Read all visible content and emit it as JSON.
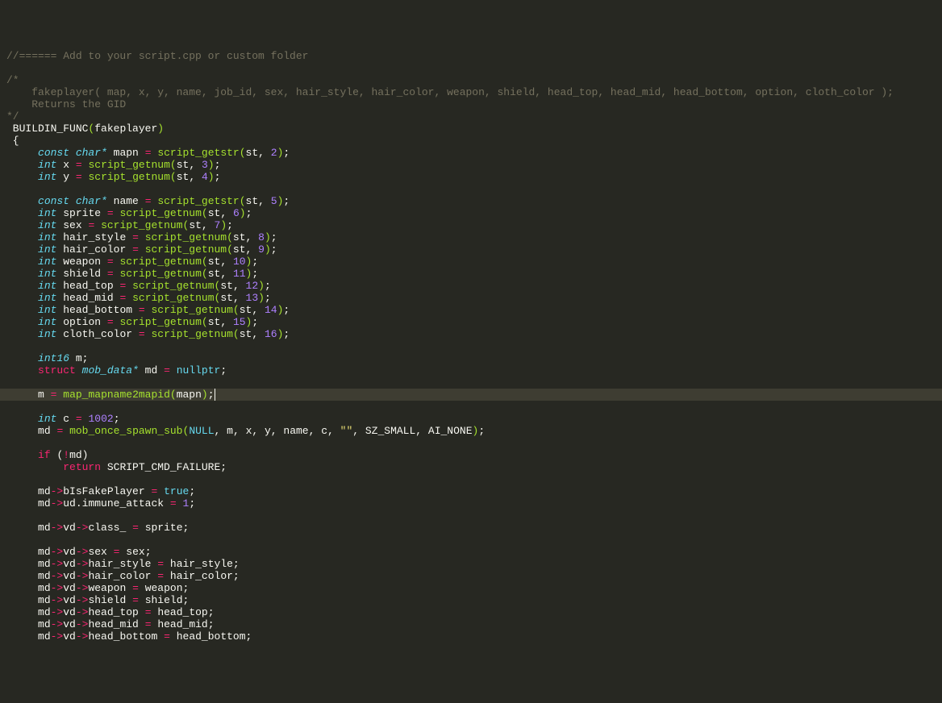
{
  "comment_header": "//====== Add to your script.cpp or custom folder",
  "comment_block": {
    "open": "/*",
    "line1": "    fakeplayer( map, x, y, name, job_id, sex, hair_style, hair_color, weapon, shield, head_top, head_mid, head_bottom, option, cloth_color );",
    "line2": "    Returns the GID",
    "close": "*/"
  },
  "buildin_func": "BUILDIN_FUNC",
  "funcname": "fakeplayer",
  "types": {
    "const_char_star": "const char*",
    "int": "int",
    "int16": "int16",
    "struct": "struct",
    "mob_data": "mob_data*"
  },
  "kw": {
    "if": "if",
    "return": "return",
    "nullptr": "nullptr",
    "true": "true"
  },
  "calls": {
    "script_getstr": "script_getstr",
    "script_getnum": "script_getnum",
    "map_mapname2mapid": "map_mapname2mapid",
    "mob_once_spawn_sub": "mob_once_spawn_sub"
  },
  "consts": {
    "NULL": "NULL",
    "SZ_SMALL": "SZ_SMALL",
    "AI_NONE": "AI_NONE",
    "SCRIPT_CMD_FAILURE": "SCRIPT_CMD_FAILURE"
  },
  "vars": {
    "mapn": "mapn",
    "x": "x",
    "y": "y",
    "name": "name",
    "sprite": "sprite",
    "sex": "sex",
    "hair_style": "hair_style",
    "hair_color": "hair_color",
    "weapon": "weapon",
    "shield": "shield",
    "head_top": "head_top",
    "head_mid": "head_mid",
    "head_bottom": "head_bottom",
    "option": "option",
    "cloth_color": "cloth_color",
    "m": "m",
    "md": "md",
    "c": "c",
    "st": "st",
    "bIsFakePlayer": "bIsFakePlayer",
    "ud": "ud",
    "immune_attack": "immune_attack",
    "vd": "vd",
    "class_": "class_"
  },
  "nums": {
    "n2": "2",
    "n3": "3",
    "n4": "4",
    "n5": "5",
    "n6": "6",
    "n7": "7",
    "n8": "8",
    "n9": "9",
    "n10": "10",
    "n11": "11",
    "n12": "12",
    "n13": "13",
    "n14": "14",
    "n15": "15",
    "n16": "16",
    "n1002": "1002",
    "n1": "1"
  },
  "str_empty": "\"\""
}
